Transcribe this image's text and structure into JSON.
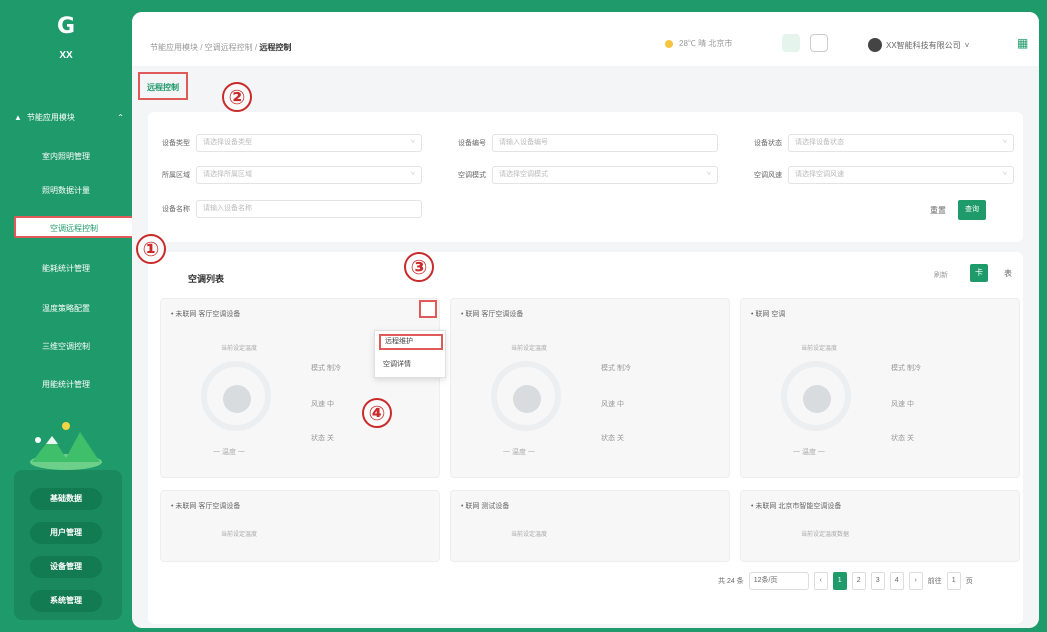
{
  "app": {
    "logo_glyph": "G",
    "logo_text": "XX"
  },
  "sidebar": {
    "group_label": "节能应用模块",
    "items": [
      {
        "label": "室内照明管理"
      },
      {
        "label": "照明数据计量"
      },
      {
        "label": "空调远程控制"
      },
      {
        "label": "能耗统计管理"
      },
      {
        "label": "温度策略配置"
      },
      {
        "label": "三维空调控制"
      },
      {
        "label": "用能统计管理"
      }
    ],
    "bottom_buttons": [
      {
        "label": "基础数据"
      },
      {
        "label": "用户管理"
      },
      {
        "label": "设备管理"
      },
      {
        "label": "系统管理"
      }
    ]
  },
  "header": {
    "breadcrumb": [
      "节能应用模块",
      "空调远程控制"
    ],
    "breadcrumb_current": "远程控制",
    "weather": "28℃ 晴 北京市",
    "user": "XX智能科技有限公司"
  },
  "tabs": [
    {
      "label": "远程控制"
    },
    {
      "label": ""
    }
  ],
  "filters": {
    "fields": [
      {
        "label": "设备类型",
        "placeholder": "请选择设备类型"
      },
      {
        "label": "设备编号",
        "placeholder": "请输入设备编号"
      },
      {
        "label": "设备状态",
        "placeholder": "请选择设备状态"
      },
      {
        "label": "所属区域",
        "placeholder": "请选择所属区域"
      },
      {
        "label": "空调模式",
        "placeholder": "请选择空调模式"
      },
      {
        "label": "空调风速",
        "placeholder": "请选择空调风速"
      },
      {
        "label": "设备名称",
        "placeholder": "请输入设备名称"
      }
    ],
    "reset_label": "重置",
    "query_label": "查询"
  },
  "list": {
    "title": "空调列表",
    "view_toggle": [
      "刷新",
      "卡",
      "表"
    ],
    "cards": [
      {
        "title": "• 未联网  客厅空调设备",
        "sub": "当前设定温度",
        "rows": [
          "模式  制冷",
          "风速  中",
          "状态  关"
        ],
        "mode": "一  温度  一"
      },
      {
        "title": "• 联网  客厅空调设备",
        "sub": "当前设定温度",
        "rows": [
          "模式  制冷",
          "风速  中",
          "状态  关"
        ],
        "mode": "一  温度  一"
      },
      {
        "title": "• 联网  空调",
        "sub": "当前设定温度",
        "rows": [
          "模式  制冷",
          "风速  中",
          "状态  关"
        ],
        "mode": "一  温度  一"
      },
      {
        "title": "• 未联网  客厅空调设备",
        "sub": "当前设定温度",
        "rows": [],
        "mode": ""
      },
      {
        "title": "• 联网  测试设备",
        "sub": "当前设定温度",
        "rows": [],
        "mode": ""
      },
      {
        "title": "• 未联网  北京市智能空调设备",
        "sub": "当前设定温度数据",
        "rows": [],
        "mode": ""
      }
    ]
  },
  "menu": {
    "items": [
      "远程维护",
      "空调详情"
    ]
  },
  "markers": [
    "①",
    "②",
    "③",
    "④"
  ],
  "pager": {
    "total": "共 24 条",
    "page_size": "12条/页",
    "pages": [
      "1",
      "2",
      "3",
      "4"
    ],
    "goto_label": "前往",
    "goto_value": "1",
    "page_suffix": "页"
  },
  "colors": {
    "brand": "#1f9a6a",
    "highlight": "#e05a5a"
  }
}
